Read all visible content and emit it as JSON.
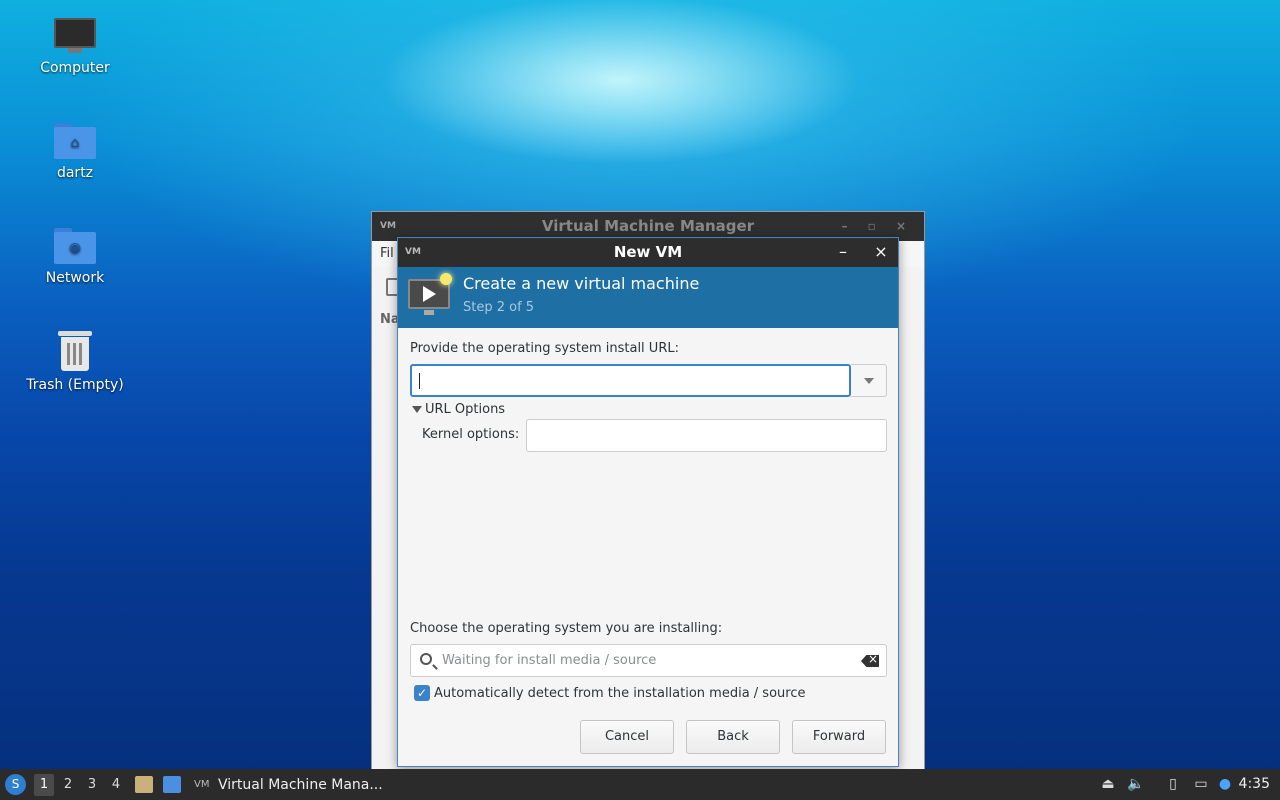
{
  "desktop": {
    "icons": [
      {
        "label": "Computer",
        "icon": "computer-icon"
      },
      {
        "label": "dartz",
        "icon": "home-folder-icon"
      },
      {
        "label": "Network",
        "icon": "network-folder-icon"
      },
      {
        "label": "Trash (Empty)",
        "icon": "trash-icon"
      }
    ]
  },
  "background_window": {
    "title": "Virtual Machine Manager",
    "menu_partial": "Fil",
    "column_partial": "Na"
  },
  "dialog": {
    "title": "New VM",
    "minimize": "–",
    "close": "×",
    "banner": {
      "heading": "Create a new virtual machine",
      "step": "Step 2 of 5"
    },
    "url_label": "Provide the operating system install URL:",
    "url_value": "",
    "url_options_label": "URL Options",
    "kernel_label": "Kernel options:",
    "kernel_value": "",
    "os_label": "Choose the operating system you are installing:",
    "os_search_placeholder": "Waiting for install media / source",
    "autodetect_label": "Automatically detect from the installation media / source",
    "autodetect_checked": true,
    "buttons": {
      "cancel": "Cancel",
      "back": "Back",
      "forward": "Forward"
    }
  },
  "taskbar": {
    "workspaces": [
      "1",
      "2",
      "3",
      "4"
    ],
    "active_workspace": "1",
    "task_label": "Virtual Machine Mana...",
    "clock": "4:35"
  },
  "colors": {
    "banner": "#1e6fa3",
    "accent": "#3a83c8",
    "titlebar": "#2d2d2d",
    "taskbar": "#2b2b2b"
  }
}
